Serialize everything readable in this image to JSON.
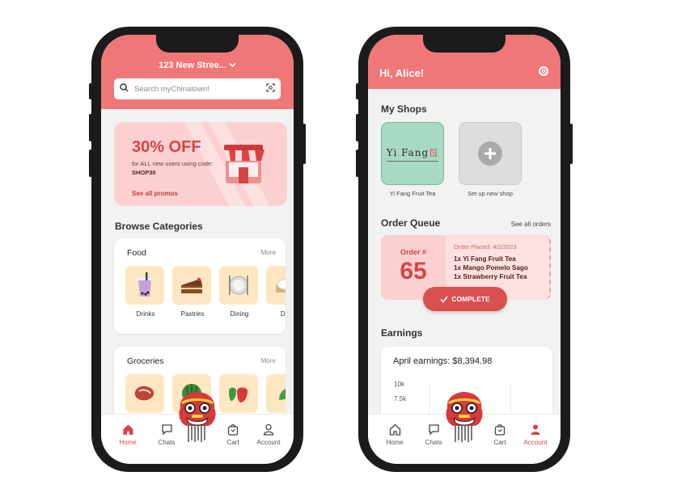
{
  "colors": {
    "brand": "#ef7777",
    "accent": "#d64545",
    "promo_bg": "#fcd0d0"
  },
  "customer": {
    "address": "123 New Stree...",
    "search": {
      "placeholder": "Search myChinatown!"
    },
    "promo": {
      "headline": "30% OFF",
      "description": "for ALL new users using code: ",
      "code": "SHOP30",
      "link": "See all promos"
    },
    "browse_title": "Browse Categories",
    "food": {
      "title": "Food",
      "more": "More",
      "items": [
        {
          "label": "Drinks",
          "icon": "bubble-tea-icon"
        },
        {
          "label": "Pastries",
          "icon": "cake-icon"
        },
        {
          "label": "Dining",
          "icon": "plate-cutlery-icon"
        },
        {
          "label": "Dim",
          "icon": "dumpling-icon"
        }
      ]
    },
    "groceries": {
      "title": "Groceries",
      "more": "More",
      "items": [
        {
          "icon": "meat-icon"
        },
        {
          "icon": "watermelon-icon"
        },
        {
          "icon": "peppers-icon"
        },
        {
          "icon": "vegetable-icon"
        }
      ]
    },
    "nav": [
      {
        "label": "Home",
        "icon": "home-icon",
        "active": true
      },
      {
        "label": "Chats",
        "icon": "chat-icon",
        "active": false
      },
      {
        "label": "Cart",
        "icon": "bag-icon",
        "active": false
      },
      {
        "label": "Account",
        "icon": "person-icon",
        "active": false
      }
    ]
  },
  "merchant": {
    "greeting": "Hi, Alice!",
    "my_shops_title": "My Shops",
    "shops": [
      {
        "label": "Yi Fang Fruit Tea",
        "logo_text": "Yi Fang"
      },
      {
        "label": "Set up new shop"
      }
    ],
    "order_queue": {
      "title": "Order Queue",
      "see_all": "See all orders",
      "order_label": "Order #",
      "order_number": "65",
      "placed": "Order Placed: 4/2/2023",
      "items": [
        "1x Yi Fang Fruit Tea",
        "1x Mango Pomelo Sago",
        "1x Strawberry Fruit Tea"
      ],
      "complete_button": "COMPLETE"
    },
    "earnings": {
      "title": "Earnings",
      "card_title": "April earnings: $8,394.98",
      "ticks": [
        "10k",
        "7.5k"
      ]
    },
    "nav": [
      {
        "label": "Home",
        "icon": "home-icon",
        "active": false
      },
      {
        "label": "Chats",
        "icon": "chat-icon",
        "active": false
      },
      {
        "label": "Cart",
        "icon": "bag-icon",
        "active": false
      },
      {
        "label": "Account",
        "icon": "person-icon",
        "active": true
      }
    ]
  }
}
